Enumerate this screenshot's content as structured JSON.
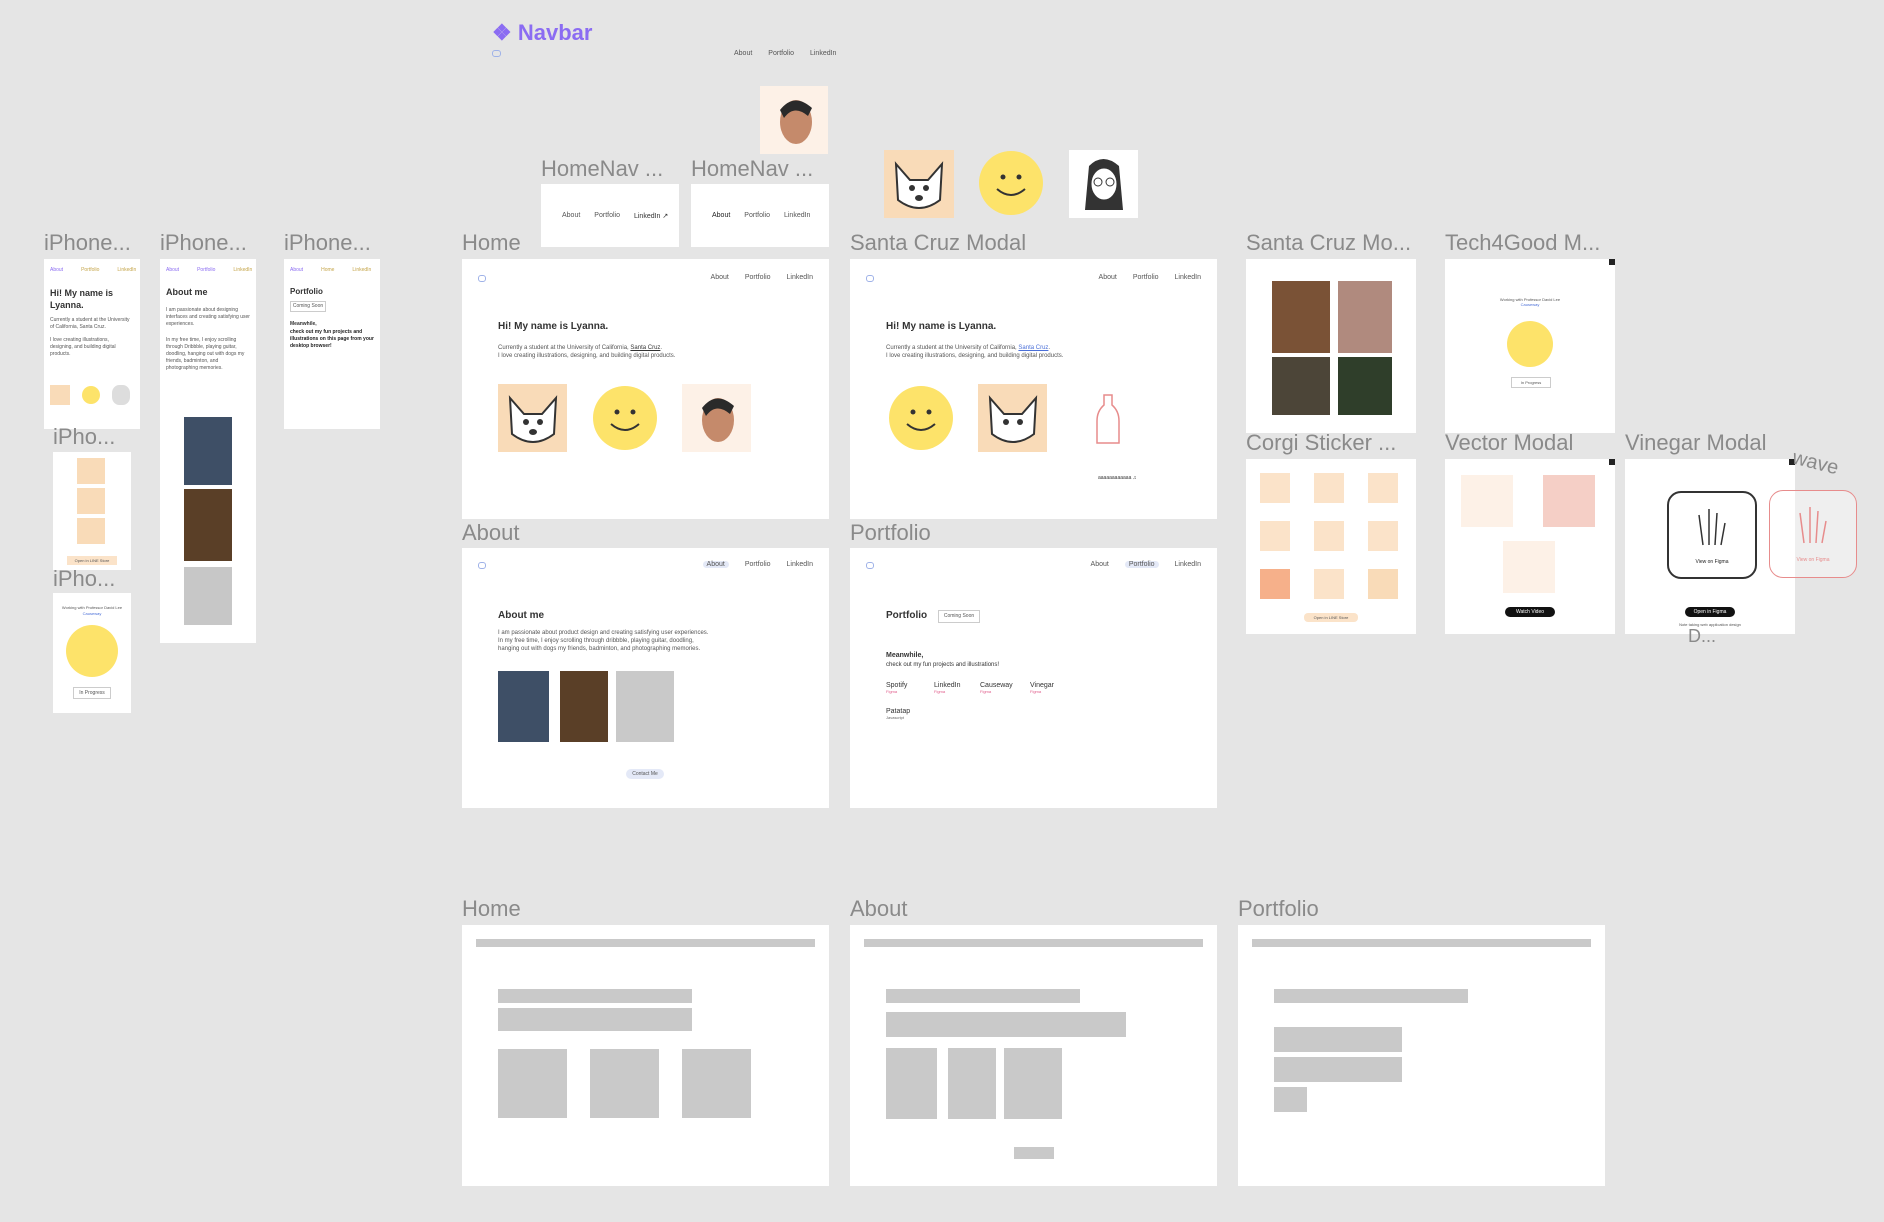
{
  "navbar_component": {
    "title": "❖ Navbar",
    "links": [
      "About",
      "Portfolio",
      "LinkedIn"
    ]
  },
  "homenav": {
    "label1": "HomeNav ...",
    "label2": "HomeNav ...",
    "links": [
      "About",
      "Portfolio",
      "LinkedIn"
    ],
    "linkedin_external": "LinkedIn ↗"
  },
  "labels": {
    "iphone1": "iPhone...",
    "iphone2": "iPhone...",
    "iphone3": "iPhone...",
    "ipho1": "iPho...",
    "ipho2": "iPho...",
    "home": "Home",
    "santa_cruz_modal": "Santa Cruz Modal",
    "santa_cruz_mo": "Santa Cruz Mo...",
    "tech4good": "Tech4Good M...",
    "corgi_sticker": "Corgi Sticker ...",
    "vector_modal": "Vector Modal",
    "vinegar_modal": "Vinegar Modal",
    "wave": "wave",
    "d_dots": "D...",
    "about": "About",
    "portfolio": "Portfolio",
    "wf_home": "Home",
    "wf_about": "About",
    "wf_portfolio": "Portfolio"
  },
  "home_page": {
    "heading": "Hi! My name is Lyanna.",
    "line1_pre": "Currently a student at the University of California, ",
    "line1_link": "Santa Cruz",
    "line1_post": ".",
    "line2": "I love creating illustrations, designing, and building digital products."
  },
  "about_page": {
    "heading": "About me",
    "line1": "I am passionate about product design and creating satisfying user experiences.",
    "line2": "In my free time, I enjoy scrolling through dribbble, playing guitar, doodling,",
    "line3": "hanging out with dogs my friends, badminton, and photographing memories.",
    "contact": "Contact Me"
  },
  "portfolio_page": {
    "heading": "Portfolio",
    "badge": "Coming Soon",
    "meanwhile": "Meanwhile,",
    "meanwhile_sub": "check out my fun projects and illustrations!",
    "projects": [
      {
        "name": "Spotify",
        "tag": "Figma"
      },
      {
        "name": "LinkedIn",
        "tag": "Figma"
      },
      {
        "name": "Causeway",
        "tag": "Figma"
      },
      {
        "name": "Vinegar",
        "tag": "Figma"
      },
      {
        "name": "Patatap",
        "tag": "Javascript"
      }
    ]
  },
  "santa_cruz": {
    "caption": "aaaaaaaaaaaa ♫"
  },
  "mobile": {
    "hi_title": "Hi! My name is Lyanna.",
    "hi_body1": "Currently a student at the University of California, Santa Cruz.",
    "hi_body2": "I love creating illustrations, designing, and building digital products.",
    "about_title": "About me",
    "about_body1": "I am passionate about designing interfaces and creating satisfying user experiences.",
    "about_body2": "In my free time, I enjoy scrolling through Dribbble, playing guitar, doodling, hanging out with dogs my friends, badminton, and photographing memories.",
    "portfolio_title": "Portfolio",
    "portfolio_badge": "Coming Soon",
    "portfolio_meanwhile": "Meanwhile,",
    "portfolio_body": "check out my fun projects and illustrations on this page from your desktop browser!",
    "line_store": "Open in LINE Store",
    "t4g_line": "Working with Professor David Lee",
    "t4g_link": "Causeway",
    "in_progress": "In Progress"
  },
  "tech4good": {
    "line": "Working with Professor David Lee",
    "link": "Causeway",
    "status": "In Progress"
  },
  "corgi": {
    "store": "Open in LINE Store"
  },
  "vector": {
    "button": "Watch Video"
  },
  "vinegar": {
    "view": "View on Figma",
    "open": "Open in Figma",
    "note": "Note taking web application design"
  },
  "colors": {
    "accent": "#8b6cf2",
    "smiley": "#fde36a",
    "corgi_bg": "#f9dbb8",
    "link": "#4a6fd8"
  }
}
